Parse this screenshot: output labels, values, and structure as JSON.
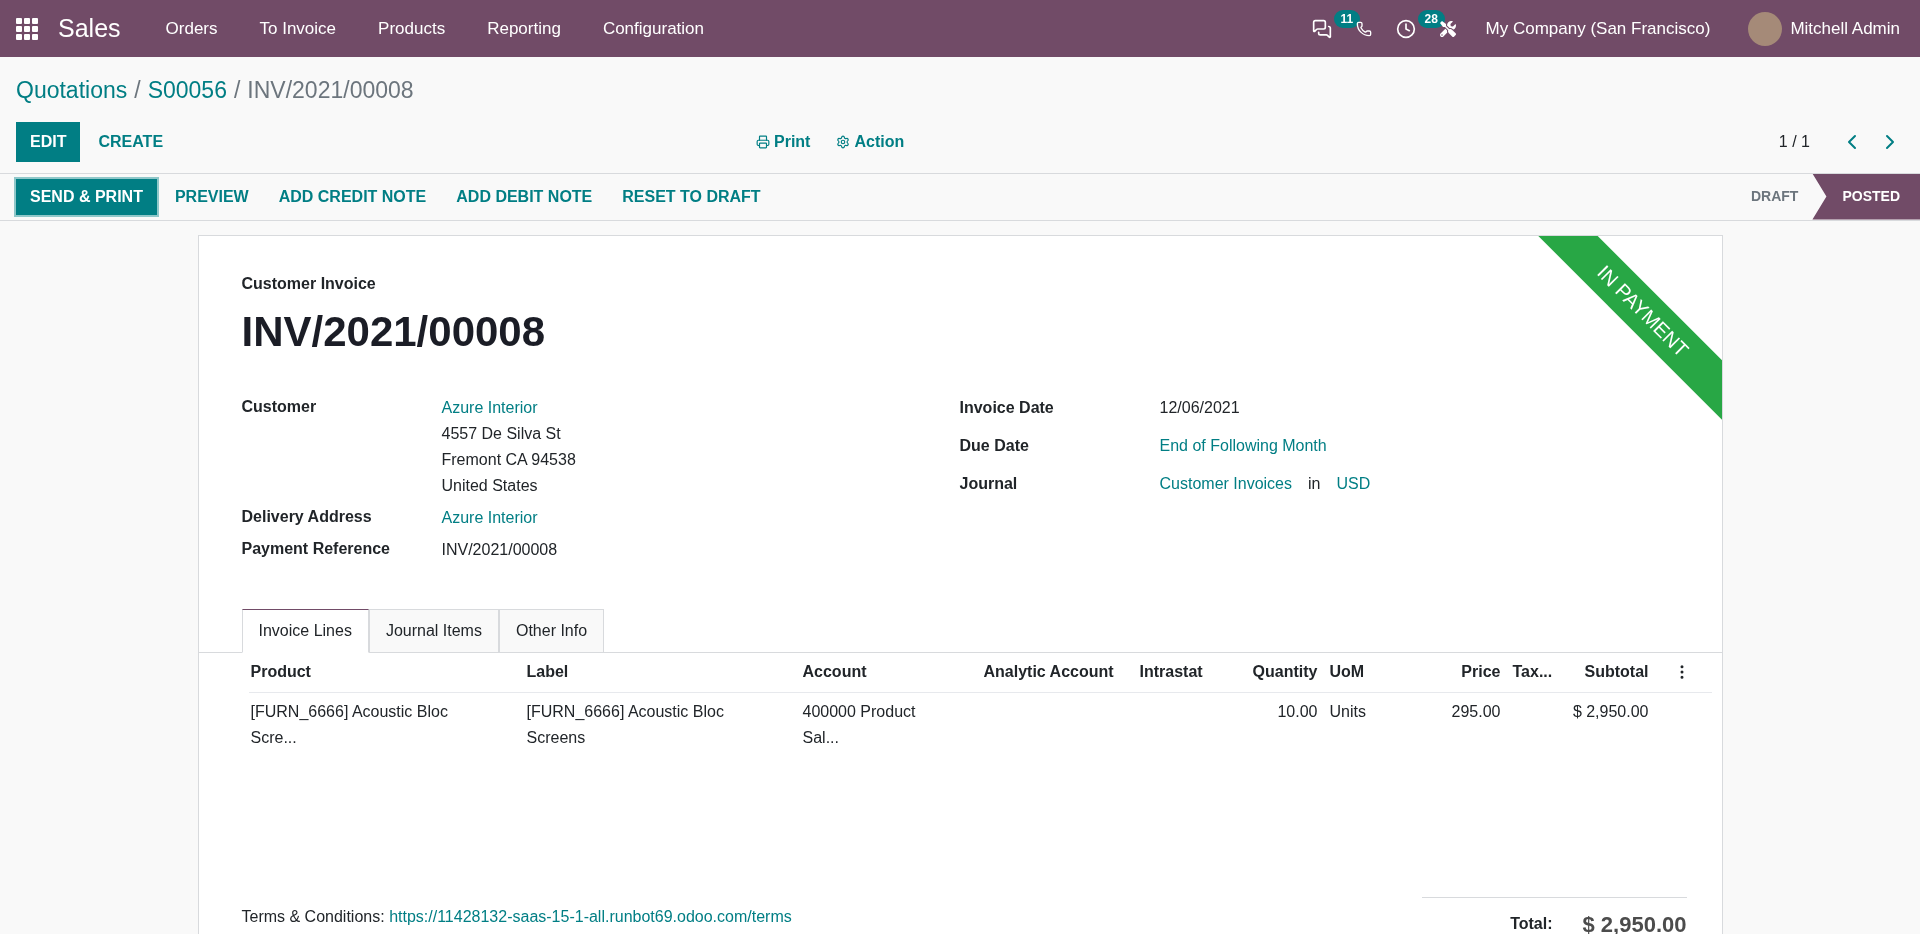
{
  "navbar": {
    "app_name": "Sales",
    "menu": [
      "Orders",
      "To Invoice",
      "Products",
      "Reporting",
      "Configuration"
    ],
    "systray": [
      {
        "kind": "chat",
        "badge": "11"
      },
      {
        "kind": "phone"
      },
      {
        "kind": "activity",
        "badge": "28"
      },
      {
        "kind": "tools"
      }
    ],
    "company": "My Company (San Francisco)",
    "user": "Mitchell Admin"
  },
  "breadcrumb": [
    {
      "label": "Quotations",
      "link": true
    },
    {
      "separator": "/",
      "label": "S00056",
      "link": true
    },
    {
      "separator": "/",
      "label": "INV/2021/00008",
      "link": false
    }
  ],
  "control_panel": {
    "buttons": [
      {
        "label": "EDIT",
        "primary": true
      },
      {
        "label": "CREATE",
        "primary": false
      }
    ],
    "print": "Print",
    "action": "Action",
    "pager": "1 / 1"
  },
  "actions": [
    {
      "label": "SEND & PRINT",
      "primary": true
    },
    {
      "label": "PREVIEW",
      "primary": false
    },
    {
      "label": "ADD CREDIT NOTE",
      "primary": false
    },
    {
      "label": "ADD DEBIT NOTE",
      "primary": false
    },
    {
      "label": "RESET TO DRAFT",
      "primary": false
    }
  ],
  "status_bar": [
    {
      "label": "DRAFT",
      "selected": false
    },
    {
      "label": "POSTED",
      "selected": true
    }
  ],
  "sheet": {
    "ribbon": "IN PAYMENT",
    "type_label": "Customer Invoice",
    "title": "INV/2021/00008",
    "left_fields": [
      {
        "label": "Customer",
        "value": "Azure Interior",
        "link": true,
        "lines": [
          "4557 De Silva St",
          "Fremont CA 94538",
          "United States"
        ]
      },
      {
        "label": "Delivery Address",
        "value": "Azure Interior",
        "link": true
      },
      {
        "label": "Payment Reference",
        "value": "INV/2021/00008",
        "link": false
      }
    ],
    "right_fields": [
      {
        "label": "Invoice Date",
        "value": "12/06/2021",
        "link": false
      },
      {
        "label": "Due Date",
        "value": "End of Following Month",
        "link": true
      },
      {
        "label": "Journal",
        "value": "Customer Invoices",
        "link": true,
        "joiner": "in",
        "extra": "USD"
      }
    ],
    "tabs": [
      {
        "label": "Invoice Lines",
        "selected": true
      },
      {
        "label": "Journal Items",
        "selected": false
      },
      {
        "label": "Other Info",
        "selected": false
      }
    ],
    "table": {
      "columns": [
        "Product",
        "Label",
        "Account",
        "Analytic Account",
        "Intrastat",
        "Quantity",
        "UoM",
        "Price",
        "Tax...",
        "Subtotal"
      ],
      "rows": [
        [
          "[FURN_6666] Acoustic Bloc Scre...",
          "[FURN_6666] Acoustic Bloc Screens",
          "400000 Product Sal...",
          "",
          "",
          "10.00",
          "Units",
          "295.00",
          "",
          "$ 2,950.00"
        ]
      ]
    },
    "terms_label": "Terms & Conditions:",
    "terms_link": "https://11428132-saas-15-1-all.runbot69.odoo.com/terms",
    "total_label": "Total:",
    "total": "$ 2,950.00"
  }
}
